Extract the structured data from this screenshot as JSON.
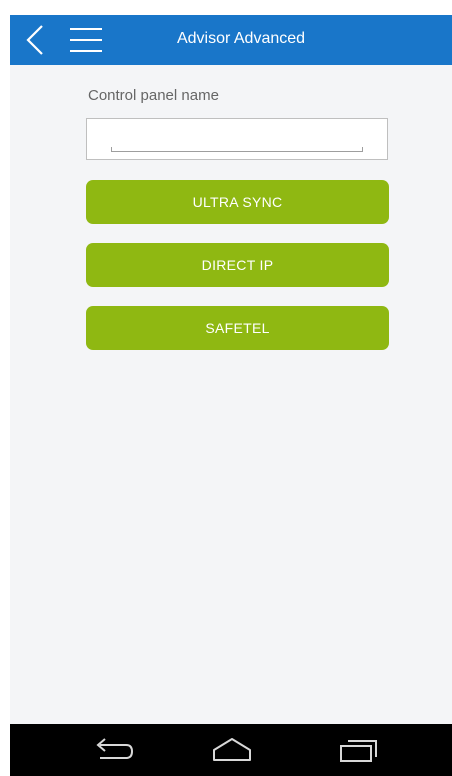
{
  "topbar": {
    "title": "Advisor Advanced",
    "color": "#1976c9",
    "back_icon": "back-chevron-icon",
    "menu_icon": "hamburger-menu-icon"
  },
  "form": {
    "field_label": "Control panel name",
    "input_value": "",
    "input_placeholder": ""
  },
  "buttons": [
    {
      "label": "ULTRA SYNC"
    },
    {
      "label": "DIRECT IP"
    },
    {
      "label": "SAFETEL"
    }
  ],
  "button_color": "#8fb812",
  "navbar": {
    "icons": [
      "nav-back-icon",
      "nav-home-icon",
      "nav-recents-icon"
    ]
  }
}
